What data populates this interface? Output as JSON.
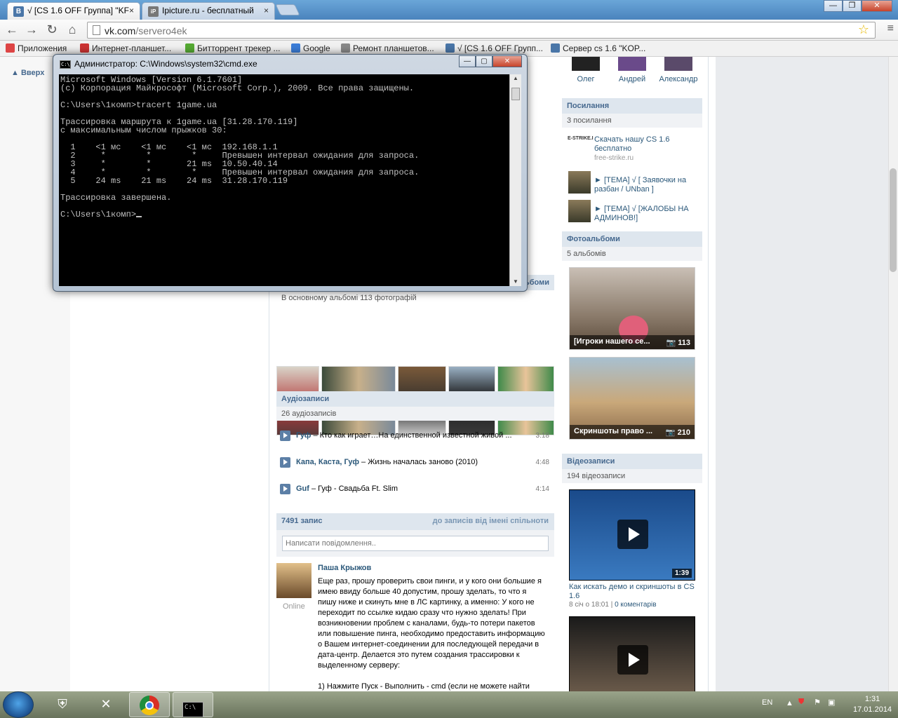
{
  "browser": {
    "tabs": [
      {
        "icon_letter": "B",
        "label": "√ [CS 1.6 OFF Группа] \"KF"
      },
      {
        "icon_letter": "iP",
        "label": "Ipicture.ru - бесплатный"
      }
    ],
    "tab_close": "×",
    "url_host": "vk.com",
    "url_path": "/servero4ek",
    "bookmarks": [
      {
        "label": "Приложения",
        "color": "#d44"
      },
      {
        "label": "Интернет-планшет...",
        "color": "#c33"
      },
      {
        "label": "Битторрент трекер ...",
        "color": "#5a3"
      },
      {
        "label": "Google",
        "color": "#3b7dd8"
      },
      {
        "label": "Ремонт планшетов...",
        "color": "#888"
      },
      {
        "label": "√ [CS 1.6 OFF Групп...",
        "color": "#4a76a8"
      },
      {
        "label": "Сервер cs 1.6 \"KOP...",
        "color": "#4a76a8"
      }
    ]
  },
  "vk": {
    "up_label": "Вверх",
    "friends": [
      "Олег",
      "Андрей",
      "Александр"
    ],
    "links_header": "Посилання",
    "links_count": "3 посилання",
    "links": [
      {
        "logo": "E-STRIKE.I",
        "text": "Скачать нашу CS 1.6 бесплатно",
        "host": "free-strike.ru"
      },
      {
        "text": "► [ТЕМА] √ [ Заявочки на разбан / UNban ]"
      },
      {
        "text": "► [ТЕМА] √ [ЖАЛОБЫ НА АДМИНОВ!]"
      }
    ],
    "albums_header": "Фотоальбоми",
    "albums_count": "5 альбомів",
    "albums": [
      {
        "title": "[Игроки нашего се...",
        "count": "113"
      },
      {
        "title": "Скриншоты право ...",
        "count": "210"
      }
    ],
    "videos_header": "Відеозаписи",
    "videos_count": "194 відеозаписи",
    "video1": {
      "duration": "1:39",
      "title": "Как искать демо и скриншоты в CS 1.6",
      "date": "8 січ о 18:01",
      "comments": "0 коментарів"
    },
    "photos_header_tail": "ьбоми",
    "photos_sub": "В основному альбомі 113 фотографій",
    "audio_header": "Аудіозаписи",
    "audio_count": "26 аудіозаписів",
    "audio": [
      {
        "artist": "Гуф",
        "title": " – Кто как играет…На единственной известной живой ...",
        "duration": "3:18"
      },
      {
        "artist": "Капа, Каста, Гуф",
        "title": " – Жизнь началась заново (2010)",
        "duration": "4:48"
      },
      {
        "artist": "Guf",
        "title": " – Гуф - Свадьба Ft. Slim",
        "duration": "4:14"
      }
    ],
    "wall_count": "7491 запис",
    "wall_filter": "до записів від імені спільноти",
    "wall_placeholder": "Написати повідомлення..",
    "post": {
      "author": "Паша Крыжов",
      "status": "Online",
      "text": "Еще раз, прошу проверить свои пинги, и у кого они большие я имею ввиду больше 40 допустим, прошу зделать, то что я пишу ниже и скинуть мне в ЛС картинку, а именно: У кого не переходит по ссылке кидаю сразу что нужно зделать! При возникновении проблем с каналами, будь-то потери пакетов или повышение пинга, необходимо предоставить информацию о Вашем интернет-соединении для последующей передачи в дата-центр. Делается это путем создания трассировки к выделенному серверу:",
      "text2": "1) Нажмите Пуск - Выполнить - cmd (если не можете найти"
    }
  },
  "cmd": {
    "title": "Администратор: C:\\Windows\\system32\\cmd.exe",
    "icon_text": "C:\\",
    "lines": [
      "Microsoft Windows [Version 6.1.7601]",
      "(c) Корпорация Майкрософт (Microsoft Corp.), 2009. Все права защищены.",
      "",
      "C:\\Users\\1комп>tracert 1game.ua",
      "",
      "Трассировка маршрута к 1game.ua [31.28.170.119]",
      "с максимальным числом прыжков 30:",
      "",
      "  1    <1 мс    <1 мс    <1 мс  192.168.1.1",
      "  2     *        *        *     Превышен интервал ожидания для запроса.",
      "  3     *        *       21 ms  10.50.40.14",
      "  4     *        *        *     Превышен интервал ожидания для запроса.",
      "  5    24 ms    21 ms    24 ms  31.28.170.119",
      "",
      "Трассировка завершена.",
      ""
    ],
    "prompt": "C:\\Users\\1комп>"
  },
  "taskbar": {
    "lang": "EN",
    "time": "1:31",
    "date": "17.01.2014"
  }
}
